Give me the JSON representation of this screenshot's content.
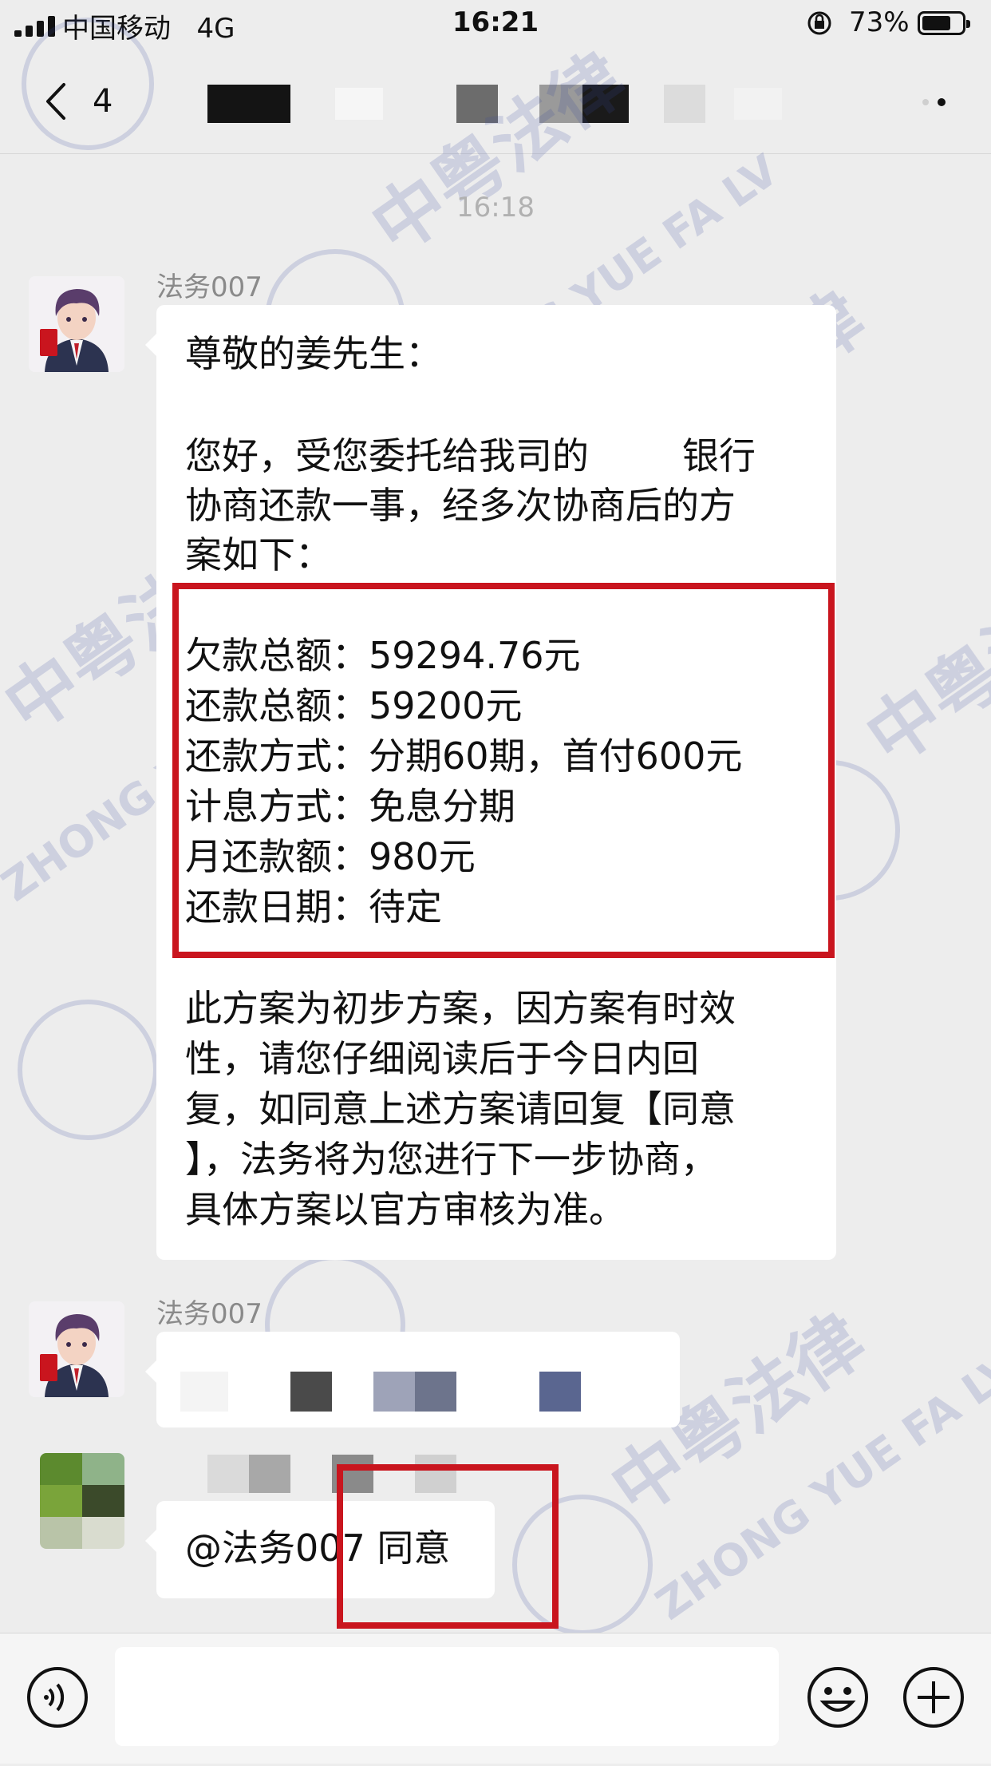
{
  "status_bar": {
    "carrier": "中国移动",
    "network": "4G",
    "time": "16:21",
    "battery_percent": "73%"
  },
  "nav": {
    "back_count": "4"
  },
  "chat": {
    "timestamp": "16:18",
    "messages": [
      {
        "sender": "法务007",
        "lines": [
          "尊敬的姜先生：",
          "",
          "您好，受您委托给我司的        银行",
          "协商还款一事，经多次协商后的方",
          "案如下：",
          "",
          "欠款总额：59294.76元",
          "还款总额：59200元",
          "还款方式：分期60期，首付600元",
          "计息方式：免息分期",
          "月还款额：980元",
          "还款日期：待定",
          "",
          "此方案为初步方案，因方案有时效",
          "性，请您仔细阅读后于今日内回",
          "复，如同意上述方案请回复【同意",
          "】，法务将为您进行下一步协商，",
          "具体方案以官方审核为准。"
        ]
      },
      {
        "sender": "法务007"
      },
      {
        "text": "@法务007 同意"
      }
    ]
  },
  "watermark": {
    "cn": "中粤法律",
    "en": "ZHONG YUE FA LV"
  },
  "colors": {
    "highlight_border": "#c9151e",
    "background": "#ededed",
    "bubble": "#ffffff"
  },
  "icons": [
    "back-chevron-icon",
    "more-icon",
    "voice-icon",
    "emoji-icon",
    "plus-icon",
    "lock-rotation-icon",
    "battery-icon",
    "signal-icon"
  ]
}
